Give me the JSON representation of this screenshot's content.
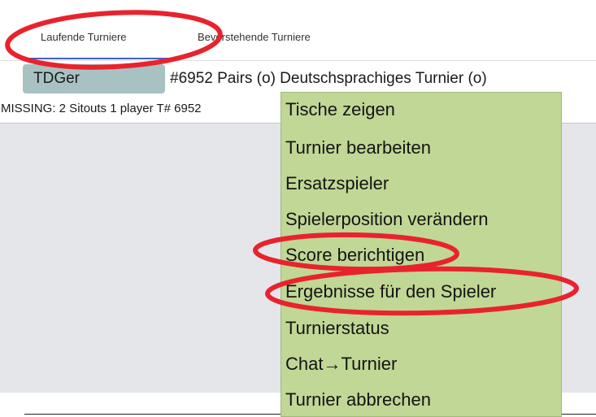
{
  "tabs": {
    "running": "Laufende Turniere",
    "upcoming": "Bevorstehende Turniere"
  },
  "tournament": {
    "director": "TDGer",
    "title": "#6952 Pairs (o) Deutschsprachiges Turnier (o)",
    "missing": "MISSING: 2 Sitouts 1 player T# 6952"
  },
  "menu": {
    "items": [
      "Tische zeigen",
      "Turnier bearbeiten",
      "Ersatzspieler",
      "Spielerposition verändern",
      "Score berichtigen",
      "Ergebnisse für den Spieler",
      "Turnierstatus",
      "Chat→Turnier",
      "Turnier abbrechen"
    ]
  },
  "colors": {
    "menu_background": "#c1d795",
    "annotation_red": "#e8232d",
    "director_badge": "#a8c2c4",
    "tab_underline": "#3f63c4",
    "panel": "#e4e6ea"
  }
}
